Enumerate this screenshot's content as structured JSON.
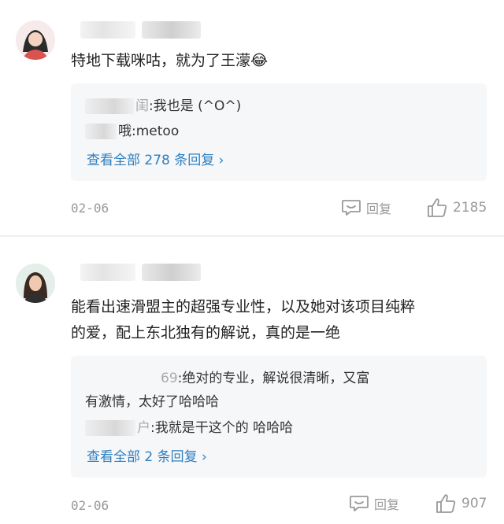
{
  "comments": [
    {
      "text": "特地下载咪咕，就为了王濛😂",
      "replies": [
        {
          "suffix": "闺",
          "text": ":我也是 (^O^)"
        },
        {
          "suffix": "哦",
          "text": ":metoo"
        }
      ],
      "view_all": "查看全部 278 条回复 ›",
      "date": "02-06",
      "reply_label": "回复",
      "likes": "2185"
    },
    {
      "text_line1": "能看出速滑盟主的超强专业性，以及她对该项目纯粹",
      "text_line2": "的爱，配上东北独有的解说，真的是一绝",
      "replies": [
        {
          "suffix": "69",
          "text": ":绝对的专业，解说很清晰，又富"
        },
        {
          "text": "有激情，太好了哈哈哈"
        },
        {
          "suffix": "户",
          "text": ":我就是干这个的  哈哈哈"
        }
      ],
      "view_all": "查看全部 2 条回复 ›",
      "date": "02-06",
      "reply_label": "回复",
      "likes": "907"
    }
  ],
  "colors": {
    "link": "#2e7fbf",
    "meta": "#999999",
    "reply_bg": "#f6f7f9"
  },
  "icons": [
    "comment-bubble-icon",
    "thumbs-up-icon"
  ]
}
